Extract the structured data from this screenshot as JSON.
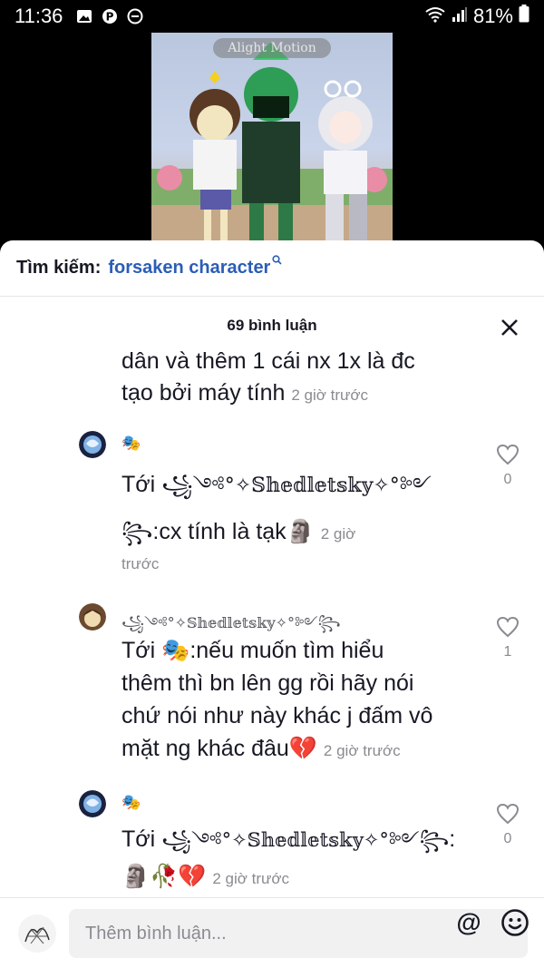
{
  "status_bar": {
    "time": "11:36",
    "battery": "81%",
    "icons": [
      "gallery-icon",
      "pinterest-icon",
      "dnd-icon",
      "wifi-icon",
      "signal-icon",
      "battery-icon"
    ]
  },
  "video": {
    "watermark": "Alight Motion"
  },
  "search": {
    "label": "Tìm kiếm:",
    "query": "forsaken character"
  },
  "comments": {
    "header": "69 bình luận",
    "items": [
      {
        "username": "",
        "text": "dân và thêm 1 cái nx 1x là đc tạo bởi máy tính",
        "line1": "dân và thêm 1 cái nx 1x là đc",
        "line2": "tạo bởi máy tính",
        "time": "2 giờ trước"
      },
      {
        "username": "🎭",
        "reply_to": "Tới",
        "mention": "꧁༺°✧𝕊𝕙𝕖𝕕𝕝𝕖𝕥𝕤𝕜𝕪✧°༻",
        "text": ":cx tính là tạk🗿",
        "time": "2 giờ",
        "time_2": "trước",
        "likes": "0"
      },
      {
        "username": "꧁༺°✧𝕊𝕙𝕖𝕕𝕝𝕖𝕥𝕤𝕜𝕪✧°༻꧂",
        "reply_to": "Tới",
        "mention": "🎭",
        "line1": ":nếu muốn tìm hiểu",
        "line2": "thêm thì bn lên gg rồi hãy nói",
        "line3": "chứ nói như này khác j đấm vô",
        "line4": "mặt ng khác đâu💔",
        "time": "2 giờ trước",
        "likes": "1"
      },
      {
        "username": "🎭",
        "reply_to": "Tới",
        "mention": "꧁༺°✧𝕊𝕙𝕖𝕕𝕝𝕖𝕥𝕤𝕜𝕪✧°༻꧂",
        "text": ":",
        "line2": "🗿🥀💔",
        "time": "2 giờ trước",
        "likes": "0"
      }
    ]
  },
  "input": {
    "placeholder": "Thêm bình luận..."
  },
  "colors": {
    "link_blue": "#2b5db7",
    "text_dark": "#161823",
    "text_gray": "#8a8b91"
  }
}
